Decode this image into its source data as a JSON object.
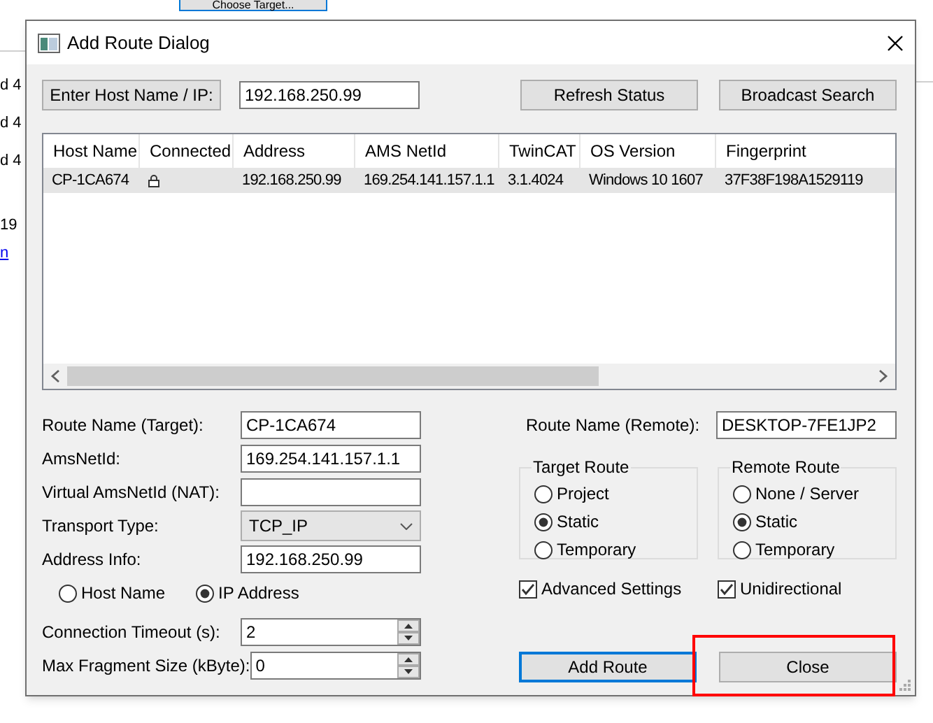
{
  "background": {
    "top_button": "Choose Target...",
    "fragments": [
      "d 4",
      "d 4",
      "d 4",
      "19"
    ],
    "link": "n"
  },
  "window": {
    "title": "Add Route Dialog"
  },
  "toolbar": {
    "host_button": "Enter Host Name / IP:",
    "host_value": "192.168.250.99",
    "refresh_button": "Refresh Status",
    "broadcast_button": "Broadcast Search"
  },
  "table": {
    "columns": [
      "Host Name",
      "Connected",
      "Address",
      "AMS NetId",
      "TwinCAT",
      "OS Version",
      "Fingerprint"
    ],
    "rows": [
      {
        "selected": true,
        "connected": true,
        "host_name": "CP-1CA674",
        "address": "192.168.250.99",
        "ams_netid": "169.254.141.157.1.1",
        "twincat": "3.1.4024",
        "os_version": "Windows 10 1607",
        "fingerprint": "37F38F198A1529119"
      }
    ]
  },
  "form": {
    "fields": [
      {
        "kind": "text",
        "label": "Route Name (Target):",
        "value": "CP-1CA674"
      },
      {
        "kind": "text",
        "label": "AmsNetId:",
        "value": "169.254.141.157.1.1"
      },
      {
        "kind": "text",
        "label": "Virtual AmsNetId (NAT):"
      },
      {
        "kind": "combo",
        "label": "Transport Type:",
        "value": "TCP_IP"
      },
      {
        "kind": "text",
        "label": "Address Info:",
        "value": "192.168.250.99"
      },
      {
        "kind": "radios",
        "options": [
          {
            "label": "Host Name",
            "selected": false
          },
          {
            "label": "IP Address",
            "selected": true
          }
        ]
      },
      {
        "kind": "spin",
        "label": "Connection Timeout (s):",
        "value": "2"
      },
      {
        "kind": "spin",
        "label": "Max Fragment Size (kByte):",
        "value": "0"
      }
    ]
  },
  "remote": {
    "label": "Route Name (Remote):",
    "value": "DESKTOP-7FE1JP2"
  },
  "groups": [
    {
      "title": "Target Route",
      "options": [
        {
          "label": "Project",
          "selected": false
        },
        {
          "label": "Static",
          "selected": true
        },
        {
          "label": "Temporary",
          "selected": false
        }
      ]
    },
    {
      "title": "Remote Route",
      "options": [
        {
          "label": "None / Server",
          "selected": false
        },
        {
          "label": "Static",
          "selected": true
        },
        {
          "label": "Temporary",
          "selected": false
        }
      ]
    }
  ],
  "checkboxes": [
    {
      "label": "Advanced Settings",
      "checked": true
    },
    {
      "label": "Unidirectional",
      "checked": true
    }
  ],
  "buttons": [
    {
      "label": "Add Route",
      "focused": true,
      "highlighted": false
    },
    {
      "label": "Close",
      "focused": false,
      "highlighted": true
    }
  ]
}
